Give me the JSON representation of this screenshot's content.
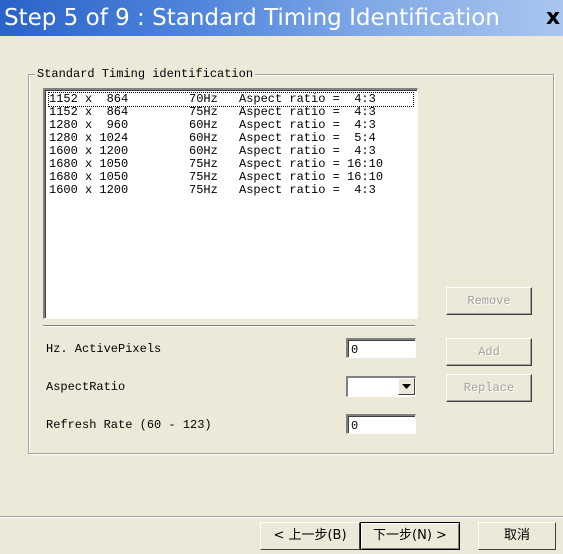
{
  "window": {
    "title": "Step 5 of 9 : Standard Timing Identification",
    "close_glyph": "x"
  },
  "group": {
    "legend": "Standard Timing identification"
  },
  "timings": [
    {
      "res": "1152 x  864",
      "hz": "70Hz",
      "aspect": "Aspect ratio =  4:3"
    },
    {
      "res": "1152 x  864",
      "hz": "75Hz",
      "aspect": "Aspect ratio =  4:3"
    },
    {
      "res": "1280 x  960",
      "hz": "60Hz",
      "aspect": "Aspect ratio =  4:3"
    },
    {
      "res": "1280 x 1024",
      "hz": "60Hz",
      "aspect": "Aspect ratio =  5:4"
    },
    {
      "res": "1600 x 1200",
      "hz": "60Hz",
      "aspect": "Aspect ratio =  4:3"
    },
    {
      "res": "1680 x 1050",
      "hz": "75Hz",
      "aspect": "Aspect ratio = 16:10"
    },
    {
      "res": "1680 x 1050",
      "hz": "75Hz",
      "aspect": "Aspect ratio = 16:10"
    },
    {
      "res": "1600 x 1200",
      "hz": "75Hz",
      "aspect": "Aspect ratio =  4:3"
    }
  ],
  "buttons": {
    "remove": "Remove",
    "add": "Add",
    "replace": "Replace"
  },
  "fields": {
    "hz_active_label": "Hz. ActivePixels",
    "hz_active_value": "0",
    "aspect_label": "AspectRatio",
    "aspect_value": "",
    "refresh_label": "Refresh Rate (60 - 123)",
    "refresh_value": "0"
  },
  "nav": {
    "back": "< 上一步(B)",
    "next": "下一步(N) >",
    "cancel": "取消"
  }
}
